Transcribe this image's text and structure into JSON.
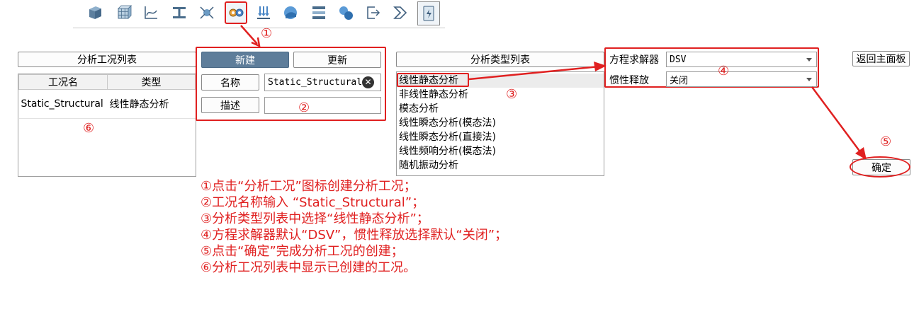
{
  "toolbar": {
    "icons": [
      "solid-icon",
      "mesh-icon",
      "curve-icon",
      "beam-icon",
      "connection-icon",
      "analysis-case-icon",
      "load-icon",
      "sphere-icon",
      "press-icon",
      "contact-icon",
      "export-icon",
      "next-icon",
      "calculator-icon"
    ]
  },
  "case_list": {
    "title": "分析工况列表",
    "columns": [
      "工况名",
      "类型"
    ],
    "rows": [
      {
        "name": "Static_Structural",
        "type": "线性静态分析"
      }
    ]
  },
  "form": {
    "new_label": "新建",
    "update_label": "更新",
    "name_label": "名称",
    "name_value": "Static_Structural",
    "desc_label": "描述",
    "desc_value": ""
  },
  "type_list": {
    "title": "分析类型列表",
    "items": [
      "线性静态分析",
      "非线性静态分析",
      "模态分析",
      "线性瞬态分析(模态法)",
      "线性瞬态分析(直接法)",
      "线性频响分析(模态法)",
      "随机振动分析"
    ],
    "selected": "线性静态分析"
  },
  "settings": {
    "solver_label": "方程求解器",
    "solver_value": "DSV",
    "inertia_label": "惯性释放",
    "inertia_value": "关闭"
  },
  "return_label": "返回主面板",
  "confirm_label": "确定",
  "markers": {
    "m1": "①",
    "m2": "②",
    "m3": "③",
    "m4": "④",
    "m5": "⑤",
    "m6": "⑥"
  },
  "instructions": [
    "①点击“分析工况”图标创建分析工况；",
    "②工况名称输入 “Static_Structural”；",
    "③分析类型列表中选择“线性静态分析”；",
    "④方程求解器默认“DSV”，惯性释放选择默认“关闭”；",
    "⑤点击“确定”完成分析工况的创建；",
    "⑥分析工况列表中显示已创建的工况。"
  ],
  "colors": {
    "annotation": "#e02020",
    "primary_button": "#5e7d9a"
  }
}
